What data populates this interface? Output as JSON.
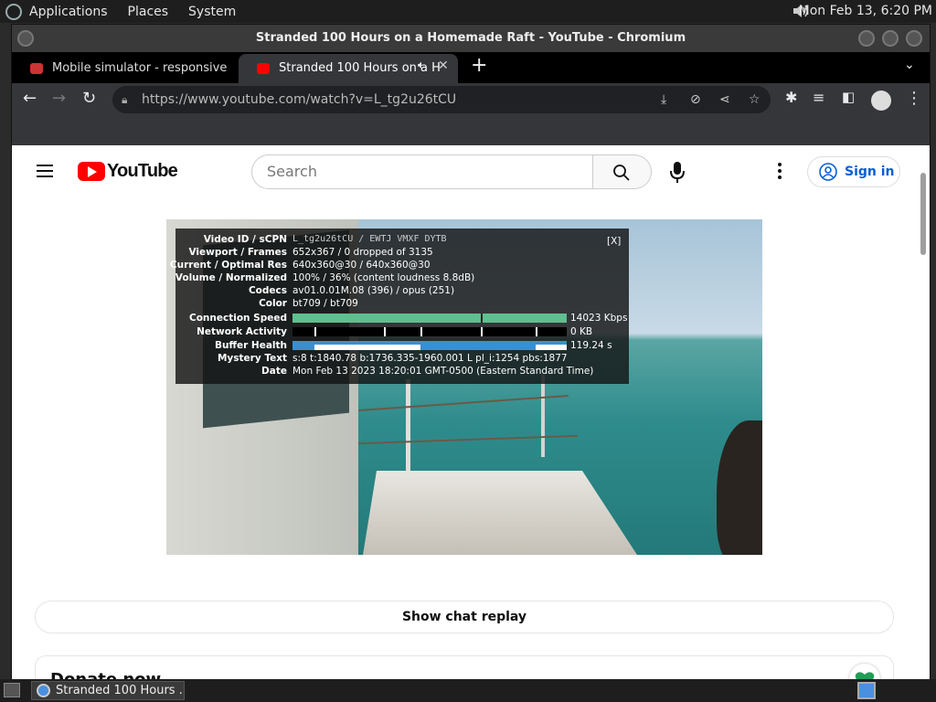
{
  "panel": {
    "menus": [
      "Applications",
      "Places",
      "System"
    ],
    "clock": "Mon Feb 13,  6:20 PM"
  },
  "window": {
    "title": "Stranded 100 Hours on a Homemade Raft - YouTube - Chromium"
  },
  "tabs": [
    {
      "label": "Mobile simulator - responsive"
    },
    {
      "label": "Stranded 100 Hours on a H"
    }
  ],
  "toolbar": {
    "url": "https://www.youtube.com/watch?v=L_tg2u26tCU"
  },
  "youtube": {
    "logo_text": "YouTube",
    "search_placeholder": "Search",
    "signin_label": "Sign in"
  },
  "stats": {
    "close_label": "[X]",
    "rows": [
      {
        "label": "Video ID / sCPN",
        "value": "L_tg2u26tCU / EWTJ VMXF DYTB"
      },
      {
        "label": "Viewport / Frames",
        "value": "652x367 / 0 dropped of 3135"
      },
      {
        "label": "Current / Optimal Res",
        "value": "640x360@30 / 640x360@30"
      },
      {
        "label": "Volume / Normalized",
        "value": "100% / 36% (content loudness 8.8dB)"
      },
      {
        "label": "Codecs",
        "value": "av01.0.01M.08 (396) / opus (251)"
      },
      {
        "label": "Color",
        "value": "bt709 / bt709"
      },
      {
        "label": "Connection Speed",
        "value": "14023 Kbps"
      },
      {
        "label": "Network Activity",
        "value": "0 KB"
      },
      {
        "label": "Buffer Health",
        "value": "119.24 s"
      },
      {
        "label": "Mystery Text",
        "value": "s:8 t:1840.78 b:1736.335-1960.001 L pl_i:1254 pbs:1877"
      },
      {
        "label": "Date",
        "value": "Mon Feb 13 2023 18:20:01 GMT-0500 (Eastern Standard Time)"
      }
    ]
  },
  "below_video": {
    "chat_replay_label": "Show chat replay",
    "donate_title": "Donate now"
  },
  "taskbar": {
    "item_label": "Stranded 100 Hours ..."
  },
  "colors": {
    "youtube_red": "#ff0000",
    "link_blue": "#065fd4",
    "stats_green": "#5fbf8f",
    "stats_blue": "#3a8fd0"
  }
}
